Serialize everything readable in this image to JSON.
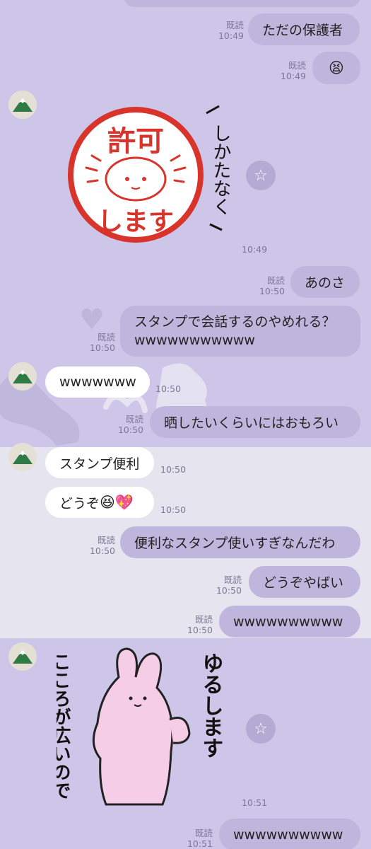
{
  "colors": {
    "background": "#cec6e9",
    "bubble_out": "#beb6dc",
    "bubble_in": "#ffffff",
    "meta_text": "#7d7796"
  },
  "messages": {
    "m1": {
      "text": "ただの保護者",
      "read": "既読",
      "time": "10:49"
    },
    "m2": {
      "emoji": "😫",
      "read": "既読",
      "time": "10:49"
    },
    "m3": {
      "sticker_big": "許可",
      "sticker_sub": "します",
      "sticker_side": "しかたなく",
      "time": "10:49"
    },
    "m4": {
      "text": "あのさ",
      "read": "既読",
      "time": "10:50"
    },
    "m5": {
      "line1": "スタンプで会話するのやめれる？",
      "line2": "wwwwwwwwwww",
      "read": "既読",
      "time": "10:50"
    },
    "m6": {
      "text": "wwwwwww",
      "time": "10:50"
    },
    "m7": {
      "text": "晒したいくらいにはおもろい",
      "read": "既読",
      "time": "10:50"
    },
    "m8": {
      "text": "スタンプ便利",
      "time": "10:50"
    },
    "m9": {
      "text": "どうぞ",
      "emoji1": "😆",
      "emoji2": "💖",
      "time": "10:50"
    },
    "m10": {
      "text": "便利なスタンプ使いすぎなんだわ",
      "read": "既読",
      "time": "10:50"
    },
    "m11": {
      "text": "どうぞやばい",
      "read": "既読",
      "time": "10:50"
    },
    "m12": {
      "text": "wwwwwwwwww",
      "read": "既読",
      "time": "10:50"
    },
    "m13": {
      "sticker_right": "ゆるします",
      "sticker_left": "こころが広いので",
      "time": "10:51"
    },
    "m14": {
      "text": "wwwwwwwwww",
      "read": "既読",
      "time": "10:51"
    }
  }
}
